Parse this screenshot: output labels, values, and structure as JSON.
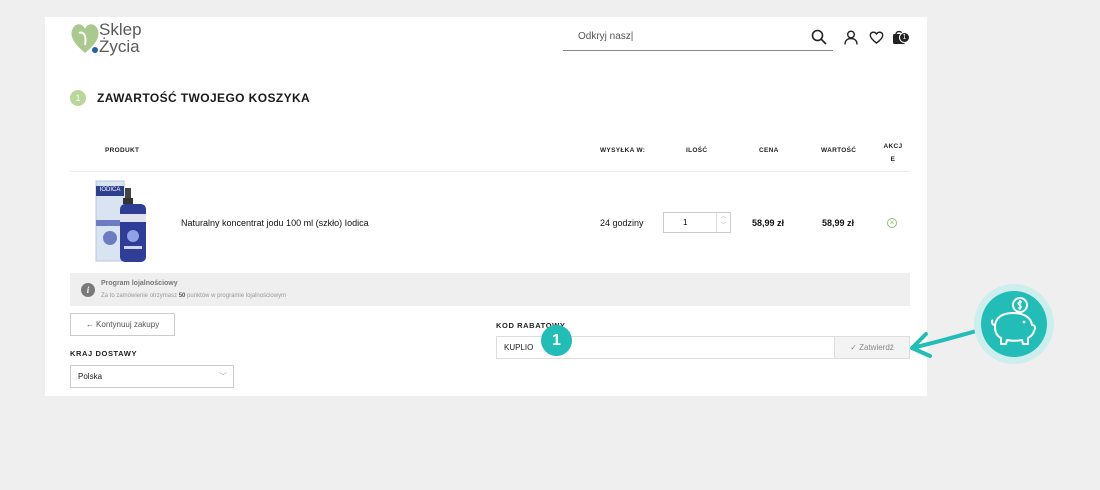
{
  "header": {
    "logo_line1": "Sklep",
    "logo_line2": "Życia",
    "search_value": "Odkryj nasz|",
    "cart_count": "1"
  },
  "cart": {
    "step_number": "1",
    "title": "ZAWARTOŚĆ TWOJEGO KOSZYKA",
    "columns": {
      "product": "PRODUKT",
      "shipping": "WYSYŁKA W:",
      "quantity": "ILOŚĆ",
      "price": "CENA",
      "value": "WARTOŚĆ",
      "actions": "AKCJE"
    },
    "items": [
      {
        "name": "Naturalny koncentrat jodu 100 ml (szkło) Iodica",
        "shipping": "24 godziny",
        "quantity": "1",
        "price": "58,99 zł",
        "value": "58,99 zł",
        "image_label": "IODICA"
      }
    ]
  },
  "loyalty": {
    "title": "Program lojalnościowy",
    "desc_before": "Za to zamówienie otrzymasz ",
    "points": "50",
    "desc_after": " punktów w programie lojalnościowym"
  },
  "continue_button": "← Kontynuuj zakupy",
  "delivery": {
    "label": "KRAJ DOSTAWY",
    "selected": "Polska"
  },
  "coupon": {
    "label": "KOD RABATOWY",
    "value": "KUPLIO",
    "apply_button": "✓ Zatwierdź"
  },
  "annotation": {
    "badge": "1",
    "accent_color": "#21bdb6"
  }
}
